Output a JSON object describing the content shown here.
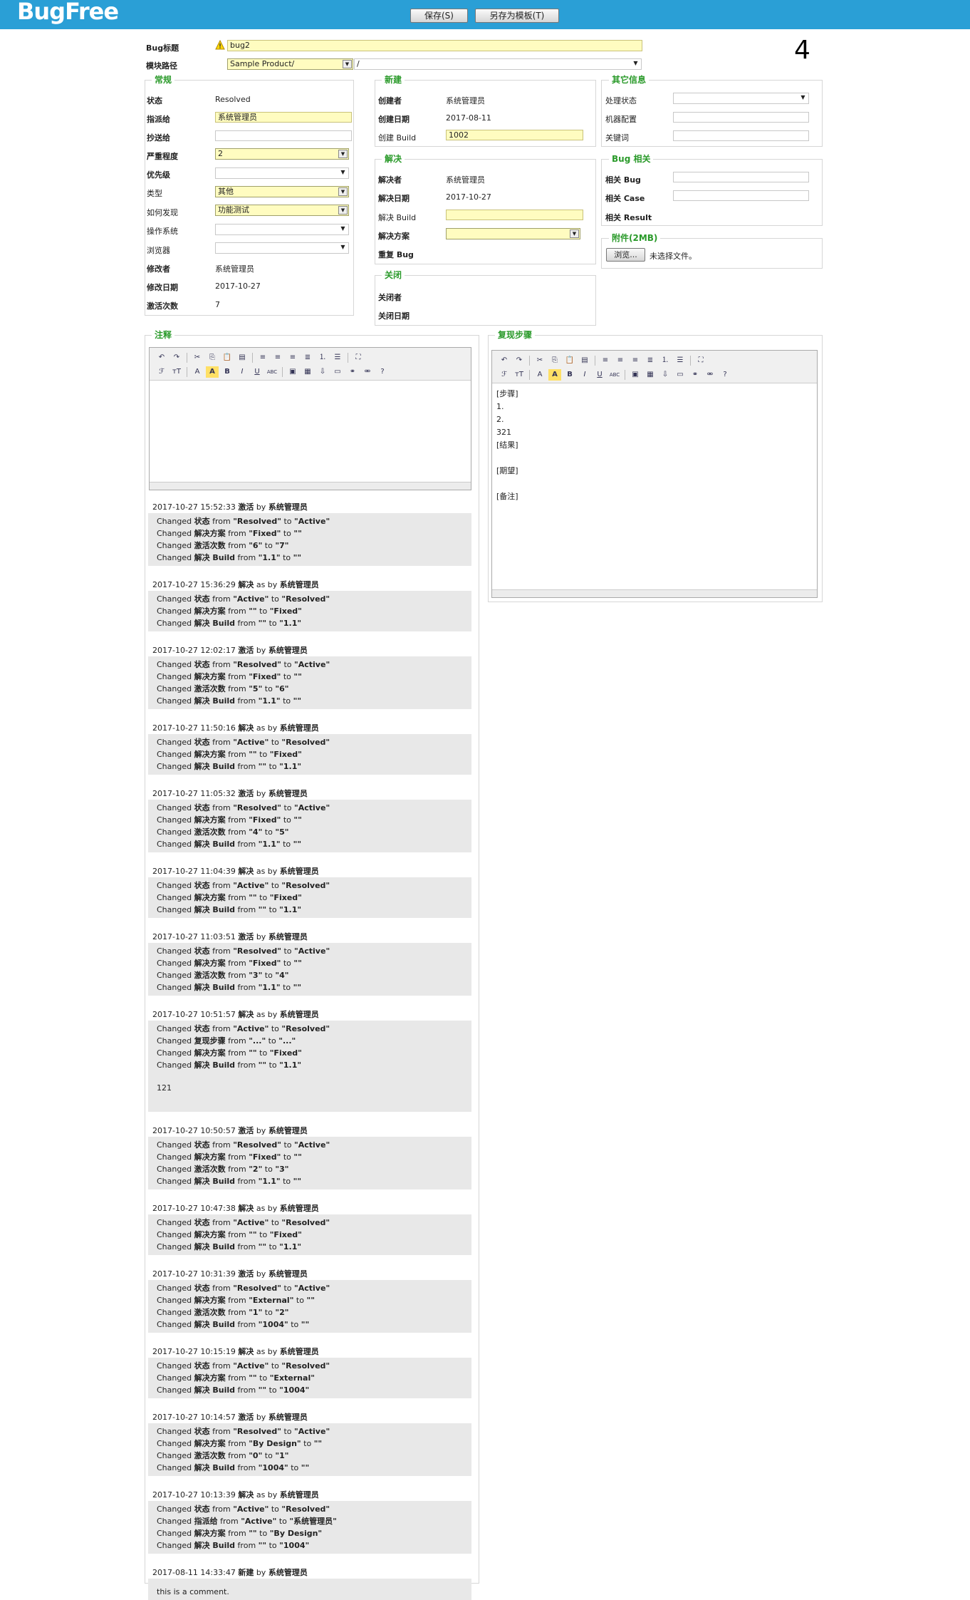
{
  "app": {
    "logo": "BugFree",
    "save_label": "保存(S)",
    "save_tpl_label": "另存为模板(T)",
    "bug_id": "4"
  },
  "top": {
    "title_label": "Bug标题",
    "title_value": "bug2",
    "module_label": "模块路径",
    "product_value": "Sample Product/",
    "module_value": "/"
  },
  "general": {
    "legend": "常规",
    "status_label": "状态",
    "status_value": "Resolved",
    "assign_label": "指派给",
    "assign_value": "系统管理员",
    "cc_label": "抄送给",
    "severity_label": "严重程度",
    "severity_value": "2",
    "priority_label": "优先级",
    "type_label": "类型",
    "type_value": "其他",
    "how_label": "如何发现",
    "how_value": "功能测试",
    "os_label": "操作系统",
    "browser_label": "浏览器",
    "modifier_label": "修改者",
    "modifier_value": "系统管理员",
    "moddate_label": "修改日期",
    "moddate_value": "2017-10-27",
    "reopen_label": "激活次数",
    "reopen_value": "7"
  },
  "created": {
    "legend": "新建",
    "creator_label": "创建者",
    "creator_value": "系统管理员",
    "date_label": "创建日期",
    "date_value": "2017-08-11",
    "build_label": "创建 Build",
    "build_value": "1002"
  },
  "resolved": {
    "legend": "解决",
    "resolver_label": "解决者",
    "resolver_value": "系统管理员",
    "date_label": "解决日期",
    "date_value": "2017-10-27",
    "build_label": "解决 Build",
    "solution_label": "解决方案",
    "dup_label": "重复 Bug"
  },
  "closed": {
    "legend": "关闭",
    "closer_label": "关闭者",
    "date_label": "关闭日期"
  },
  "other": {
    "legend": "其它信息",
    "handle_label": "处理状态",
    "machine_label": "机器配置",
    "keyword_label": "关键词"
  },
  "related": {
    "legend": "Bug 相关",
    "bug_label": "相关 Bug",
    "case_label": "相关 Case",
    "result_label": "相关 Result"
  },
  "attach": {
    "legend": "附件(2MB)",
    "browse_label": "浏览...",
    "nofile": "未选择文件。"
  },
  "comment": {
    "legend": "注释"
  },
  "repro": {
    "legend": "复现步骤",
    "text": "[步骤]\n1.\n2.\n321\n[结果]\n\n[期望]\n\n[备注]"
  },
  "history": [
    {
      "time": "2017-10-27 15:52:33",
      "action": "激活",
      "by": "by",
      "user": "系统管理员",
      "lines": [
        [
          "Changed ",
          "状态",
          " from ",
          "\"Resolved\"",
          " to ",
          "\"Active\""
        ],
        [
          "Changed ",
          "解决方案",
          " from ",
          "\"Fixed\"",
          " to ",
          "\"\""
        ],
        [
          "Changed ",
          "激活次数",
          " from ",
          "\"6\"",
          " to ",
          "\"7\""
        ],
        [
          "Changed ",
          "解决 Build",
          " from ",
          "\"1.1\"",
          " to ",
          "\"\""
        ]
      ]
    },
    {
      "time": "2017-10-27 15:36:29",
      "action": "解决",
      "by": "as by",
      "user": "系统管理员",
      "lines": [
        [
          "Changed ",
          "状态",
          " from ",
          "\"Active\"",
          " to ",
          "\"Resolved\""
        ],
        [
          "Changed ",
          "解决方案",
          " from ",
          "\"\"",
          " to ",
          "\"Fixed\""
        ],
        [
          "Changed ",
          "解决 Build",
          " from ",
          "\"\"",
          " to ",
          "\"1.1\""
        ]
      ]
    },
    {
      "time": "2017-10-27 12:02:17",
      "action": "激活",
      "by": "by",
      "user": "系统管理员",
      "lines": [
        [
          "Changed ",
          "状态",
          " from ",
          "\"Resolved\"",
          " to ",
          "\"Active\""
        ],
        [
          "Changed ",
          "解决方案",
          " from ",
          "\"Fixed\"",
          " to ",
          "\"\""
        ],
        [
          "Changed ",
          "激活次数",
          " from ",
          "\"5\"",
          " to ",
          "\"6\""
        ],
        [
          "Changed ",
          "解决 Build",
          " from ",
          "\"1.1\"",
          " to ",
          "\"\""
        ]
      ]
    },
    {
      "time": "2017-10-27 11:50:16",
      "action": "解决",
      "by": "as by",
      "user": "系统管理员",
      "lines": [
        [
          "Changed ",
          "状态",
          " from ",
          "\"Active\"",
          " to ",
          "\"Resolved\""
        ],
        [
          "Changed ",
          "解决方案",
          " from ",
          "\"\"",
          " to ",
          "\"Fixed\""
        ],
        [
          "Changed ",
          "解决 Build",
          " from ",
          "\"\"",
          " to ",
          "\"1.1\""
        ]
      ]
    },
    {
      "time": "2017-10-27 11:05:32",
      "action": "激活",
      "by": "by",
      "user": "系统管理员",
      "lines": [
        [
          "Changed ",
          "状态",
          " from ",
          "\"Resolved\"",
          " to ",
          "\"Active\""
        ],
        [
          "Changed ",
          "解决方案",
          " from ",
          "\"Fixed\"",
          " to ",
          "\"\""
        ],
        [
          "Changed ",
          "激活次数",
          " from ",
          "\"4\"",
          " to ",
          "\"5\""
        ],
        [
          "Changed ",
          "解决 Build",
          " from ",
          "\"1.1\"",
          " to ",
          "\"\""
        ]
      ]
    },
    {
      "time": "2017-10-27 11:04:39",
      "action": "解决",
      "by": "as by",
      "user": "系统管理员",
      "lines": [
        [
          "Changed ",
          "状态",
          " from ",
          "\"Active\"",
          " to ",
          "\"Resolved\""
        ],
        [
          "Changed ",
          "解决方案",
          " from ",
          "\"\"",
          " to ",
          "\"Fixed\""
        ],
        [
          "Changed ",
          "解决 Build",
          " from ",
          "\"\"",
          " to ",
          "\"1.1\""
        ]
      ]
    },
    {
      "time": "2017-10-27 11:03:51",
      "action": "激活",
      "by": "by",
      "user": "系统管理员",
      "lines": [
        [
          "Changed ",
          "状态",
          " from ",
          "\"Resolved\"",
          " to ",
          "\"Active\""
        ],
        [
          "Changed ",
          "解决方案",
          " from ",
          "\"Fixed\"",
          " to ",
          "\"\""
        ],
        [
          "Changed ",
          "激活次数",
          " from ",
          "\"3\"",
          " to ",
          "\"4\""
        ],
        [
          "Changed ",
          "解决 Build",
          " from ",
          "\"1.1\"",
          " to ",
          "\"\""
        ]
      ]
    },
    {
      "time": "2017-10-27 10:51:57",
      "action": "解决",
      "by": "as by",
      "user": "系统管理员",
      "comment": "121",
      "lines": [
        [
          "Changed ",
          "状态",
          " from ",
          "\"Active\"",
          " to ",
          "\"Resolved\""
        ],
        [
          "Changed ",
          "复现步骤",
          " from ",
          "\"...\"",
          " to ",
          "\"...\""
        ],
        [
          "Changed ",
          "解决方案",
          " from ",
          "\"\"",
          " to ",
          "\"Fixed\""
        ],
        [
          "Changed ",
          "解决 Build",
          " from ",
          "\"\"",
          " to ",
          "\"1.1\""
        ]
      ]
    },
    {
      "time": "2017-10-27 10:50:57",
      "action": "激活",
      "by": "by",
      "user": "系统管理员",
      "lines": [
        [
          "Changed ",
          "状态",
          " from ",
          "\"Resolved\"",
          " to ",
          "\"Active\""
        ],
        [
          "Changed ",
          "解决方案",
          " from ",
          "\"Fixed\"",
          " to ",
          "\"\""
        ],
        [
          "Changed ",
          "激活次数",
          " from ",
          "\"2\"",
          " to ",
          "\"3\""
        ],
        [
          "Changed ",
          "解决 Build",
          " from ",
          "\"1.1\"",
          " to ",
          "\"\""
        ]
      ]
    },
    {
      "time": "2017-10-27 10:47:38",
      "action": "解决",
      "by": "as by",
      "user": "系统管理员",
      "lines": [
        [
          "Changed ",
          "状态",
          " from ",
          "\"Active\"",
          " to ",
          "\"Resolved\""
        ],
        [
          "Changed ",
          "解决方案",
          " from ",
          "\"\"",
          " to ",
          "\"Fixed\""
        ],
        [
          "Changed ",
          "解决 Build",
          " from ",
          "\"\"",
          " to ",
          "\"1.1\""
        ]
      ]
    },
    {
      "time": "2017-10-27 10:31:39",
      "action": "激活",
      "by": "by",
      "user": "系统管理员",
      "lines": [
        [
          "Changed ",
          "状态",
          " from ",
          "\"Resolved\"",
          " to ",
          "\"Active\""
        ],
        [
          "Changed ",
          "解决方案",
          " from ",
          "\"External\"",
          " to ",
          "\"\""
        ],
        [
          "Changed ",
          "激活次数",
          " from ",
          "\"1\"",
          " to ",
          "\"2\""
        ],
        [
          "Changed ",
          "解决 Build",
          " from ",
          "\"1004\"",
          " to ",
          "\"\""
        ]
      ]
    },
    {
      "time": "2017-10-27 10:15:19",
      "action": "解决",
      "by": "as by",
      "user": "系统管理员",
      "lines": [
        [
          "Changed ",
          "状态",
          " from ",
          "\"Active\"",
          " to ",
          "\"Resolved\""
        ],
        [
          "Changed ",
          "解决方案",
          " from ",
          "\"\"",
          " to ",
          "\"External\""
        ],
        [
          "Changed ",
          "解决 Build",
          " from ",
          "\"\"",
          " to ",
          "\"1004\""
        ]
      ]
    },
    {
      "time": "2017-10-27 10:14:57",
      "action": "激活",
      "by": "by",
      "user": "系统管理员",
      "lines": [
        [
          "Changed ",
          "状态",
          " from ",
          "\"Resolved\"",
          " to ",
          "\"Active\""
        ],
        [
          "Changed ",
          "解决方案",
          " from ",
          "\"By Design\"",
          " to ",
          "\"\""
        ],
        [
          "Changed ",
          "激活次数",
          " from ",
          "\"0\"",
          " to ",
          "\"1\""
        ],
        [
          "Changed ",
          "解决 Build",
          " from ",
          "\"1004\"",
          " to ",
          "\"\""
        ]
      ]
    },
    {
      "time": "2017-10-27 10:13:39",
      "action": "解决",
      "by": "as by",
      "user": "系统管理员",
      "lines": [
        [
          "Changed ",
          "状态",
          " from ",
          "\"Active\"",
          " to ",
          "\"Resolved\""
        ],
        [
          "Changed ",
          "指派给",
          " from ",
          "\"Active\"",
          " to ",
          "\"系统管理员\""
        ],
        [
          "Changed ",
          "解决方案",
          " from ",
          "\"\"",
          " to ",
          "\"By Design\""
        ],
        [
          "Changed ",
          "解决 Build",
          " from ",
          "\"\"",
          " to ",
          "\"1004\""
        ]
      ]
    },
    {
      "time": "2017-08-11 14:33:47",
      "action": "新建",
      "by": "by",
      "user": "系统管理员",
      "comment": "this is a comment.",
      "lines": []
    }
  ],
  "colors": {
    "topbar": "#2a9fd6",
    "legend": "#2a9a2a",
    "required": "#fffcc0",
    "history_box": "#e8e8e8"
  }
}
